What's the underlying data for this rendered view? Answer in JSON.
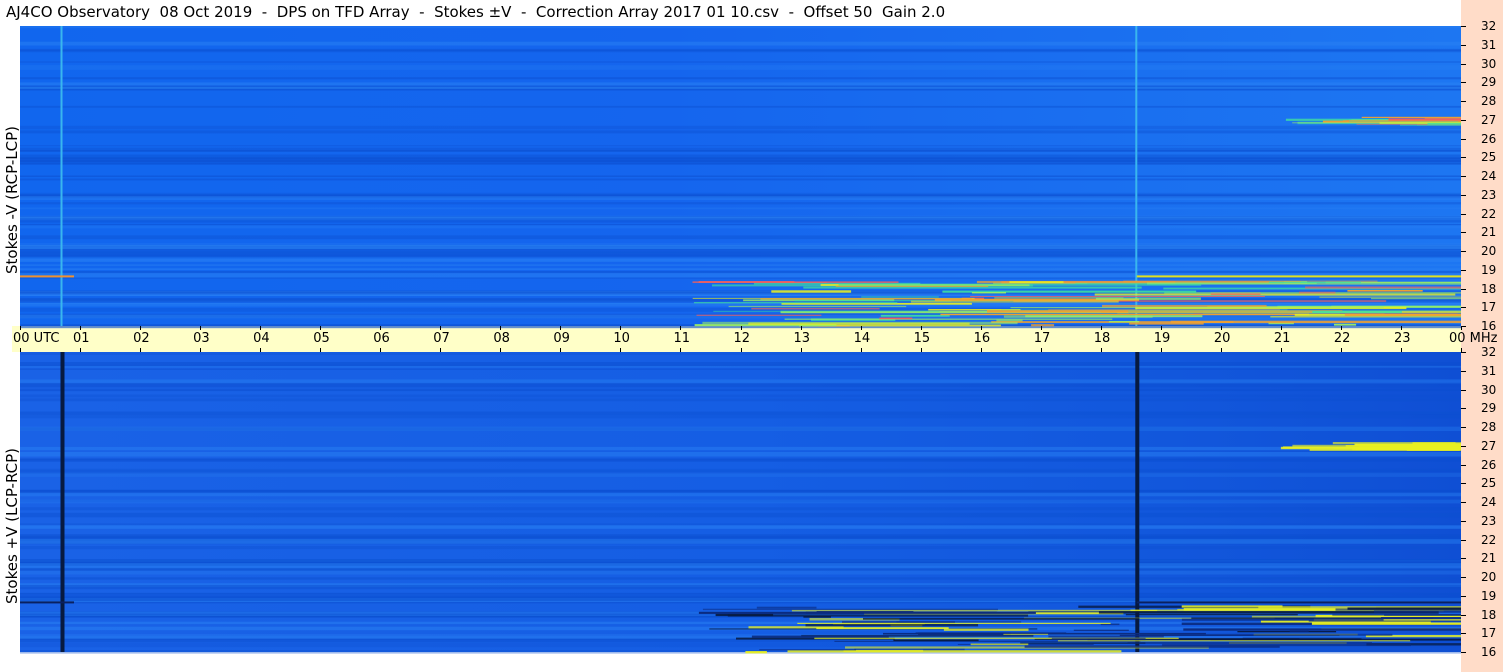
{
  "title": "AJ4CO Observatory  08 Oct 2019  -  DPS on TFD Array  -  Stokes ±V  -  Correction Array 2017 01 10.csv  -  Offset 50  Gain 2.0",
  "chart_data": [
    {
      "type": "heatmap",
      "panel": "top",
      "ylabel": "Stokes -V (RCP-LCP)",
      "x_unit": "UTC",
      "y_unit": "MHz",
      "xlim": [
        0,
        24
      ],
      "ylim": [
        16,
        32
      ],
      "x_ticks": [
        "00 UTC",
        "01",
        "02",
        "03",
        "04",
        "05",
        "06",
        "07",
        "08",
        "09",
        "10",
        "11",
        "12",
        "13",
        "14",
        "15",
        "16",
        "17",
        "18",
        "19",
        "20",
        "21",
        "22",
        "23",
        "00 MHz"
      ],
      "y_ticks": [
        "32",
        "31",
        "30",
        "29",
        "28",
        "27",
        "26",
        "25",
        "24",
        "23",
        "22",
        "21",
        "20",
        "19",
        "18",
        "17",
        "16"
      ],
      "features": [
        {
          "kind": "vertical_line",
          "t": 0.7,
          "color": "#39b6ee"
        },
        {
          "kind": "vertical_line",
          "t": 18.6,
          "color": "#39b6ee"
        },
        {
          "kind": "activity",
          "t_start": 11.2,
          "t_end": 24,
          "f_start": 16,
          "f_end": 18.5,
          "color": "#e8f020"
        },
        {
          "kind": "activity",
          "t_start": 21,
          "t_end": 24,
          "f_start": 26.8,
          "f_end": 27.2,
          "color": "#0a2a80"
        },
        {
          "kind": "horizontal_line",
          "f": 18.7,
          "t_start": 0,
          "t_end": 0.9,
          "color": "#f09030"
        },
        {
          "kind": "horizontal_line",
          "f": 18.7,
          "t_start": 18.6,
          "t_end": 24,
          "color": "#e0e020"
        }
      ]
    },
    {
      "type": "heatmap",
      "panel": "bottom",
      "ylabel": "Stokes +V (LCP-RCP)",
      "x_unit": "UTC",
      "y_unit": "MHz",
      "xlim": [
        0,
        24
      ],
      "ylim": [
        16,
        32
      ],
      "y_ticks": [
        "32",
        "31",
        "30",
        "29",
        "28",
        "27",
        "26",
        "25",
        "24",
        "23",
        "22",
        "21",
        "20",
        "19",
        "18",
        "17",
        "16"
      ],
      "features": [
        {
          "kind": "vertical_line",
          "t": 0.7,
          "color": "#071a40"
        },
        {
          "kind": "vertical_line",
          "t": 18.6,
          "color": "#071a40"
        },
        {
          "kind": "activity",
          "t_start": 11.2,
          "t_end": 24,
          "f_start": 16,
          "f_end": 18.5,
          "color": "#071a40"
        },
        {
          "kind": "activity",
          "t_start": 21,
          "t_end": 24,
          "f_start": 26.8,
          "f_end": 27.2,
          "color": "#e8f020"
        },
        {
          "kind": "horizontal_line",
          "f": 18.7,
          "t_start": 0,
          "t_end": 0.9,
          "color": "#0a2060"
        },
        {
          "kind": "horizontal_line",
          "f": 18.7,
          "t_start": 18.6,
          "t_end": 24,
          "color": "#0a2060"
        }
      ]
    }
  ]
}
